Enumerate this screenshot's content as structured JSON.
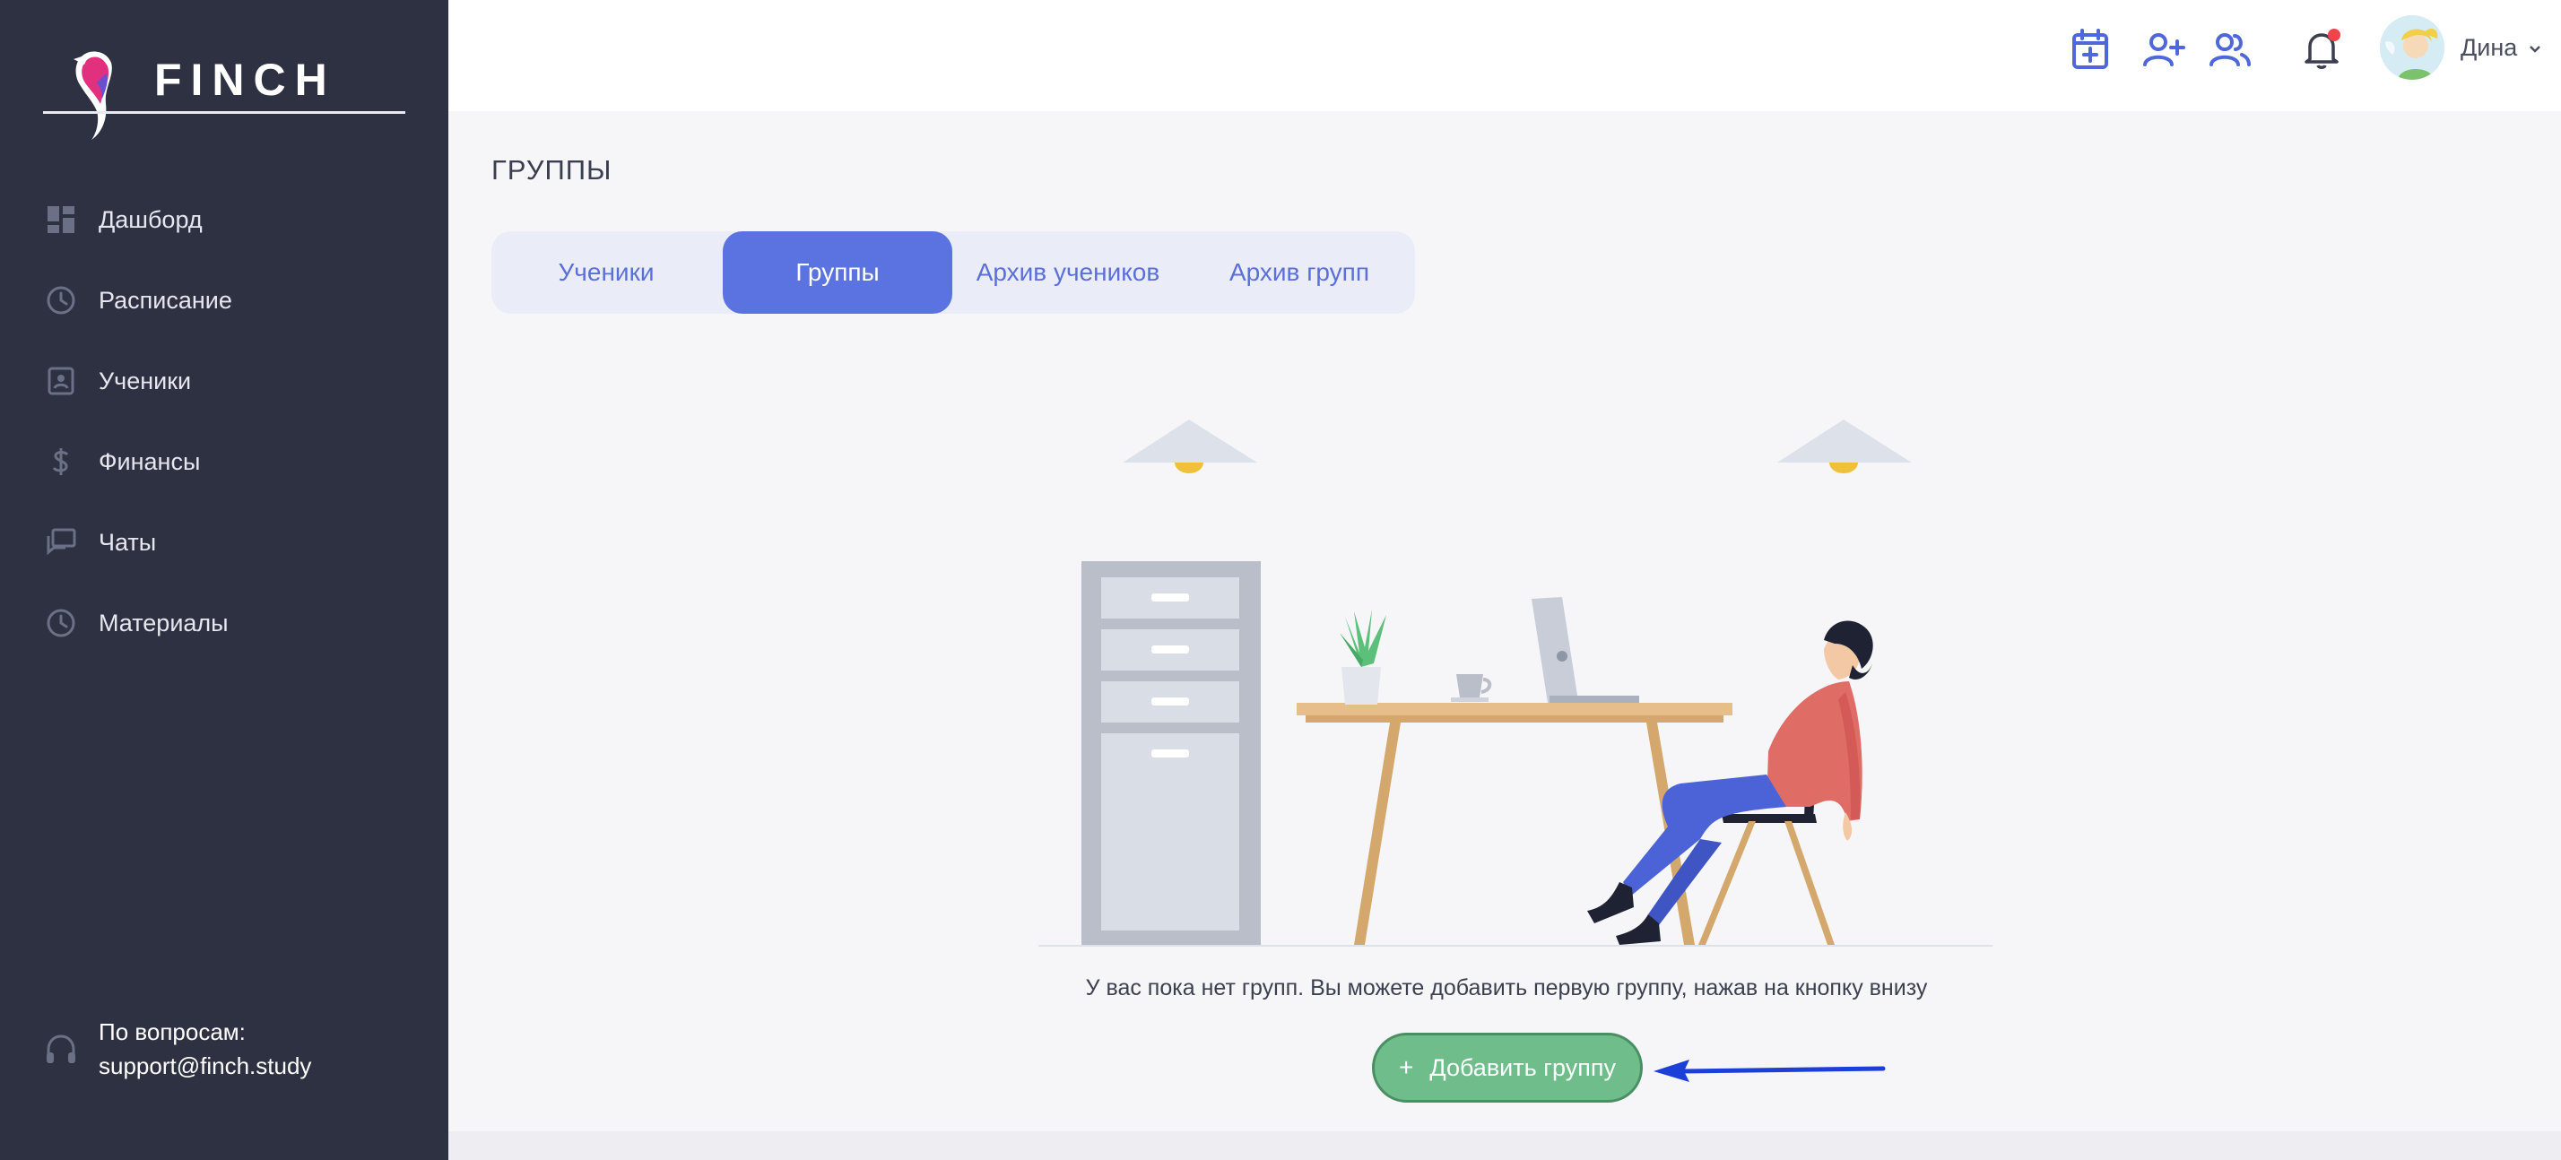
{
  "brand": {
    "name": "FINCH"
  },
  "sidebar": {
    "items": [
      {
        "label": "Дашборд",
        "icon": "dashboard-icon"
      },
      {
        "label": "Расписание",
        "icon": "clock-icon"
      },
      {
        "label": "Ученики",
        "icon": "contact-card-icon"
      },
      {
        "label": "Финансы",
        "icon": "dollar-icon"
      },
      {
        "label": "Чаты",
        "icon": "chat-icon"
      },
      {
        "label": "Материалы",
        "icon": "clock-icon"
      }
    ],
    "support": {
      "label": "По вопросам:",
      "email": "support@finch.study",
      "icon": "headset-icon"
    }
  },
  "header": {
    "icons": [
      "calendar-add-icon",
      "add-user-icon",
      "users-icon",
      "bell-icon"
    ],
    "user_name": "Дина",
    "notification": true
  },
  "main": {
    "title": "ГРУППЫ",
    "tabs": [
      {
        "label": "Ученики",
        "active": false
      },
      {
        "label": "Группы",
        "active": true
      },
      {
        "label": "Архив учеников",
        "active": false
      },
      {
        "label": "Архив групп",
        "active": false
      }
    ],
    "empty_message": "У вас пока нет групп. Вы можете добавить первую группу, нажав на кнопку внизу",
    "add_button": "Добавить группу"
  },
  "colors": {
    "sidebar_bg": "#2d3142",
    "accent": "#5b73e0",
    "add_button": "#6ebd8a",
    "annotation_arrow": "#1c3fd8"
  }
}
